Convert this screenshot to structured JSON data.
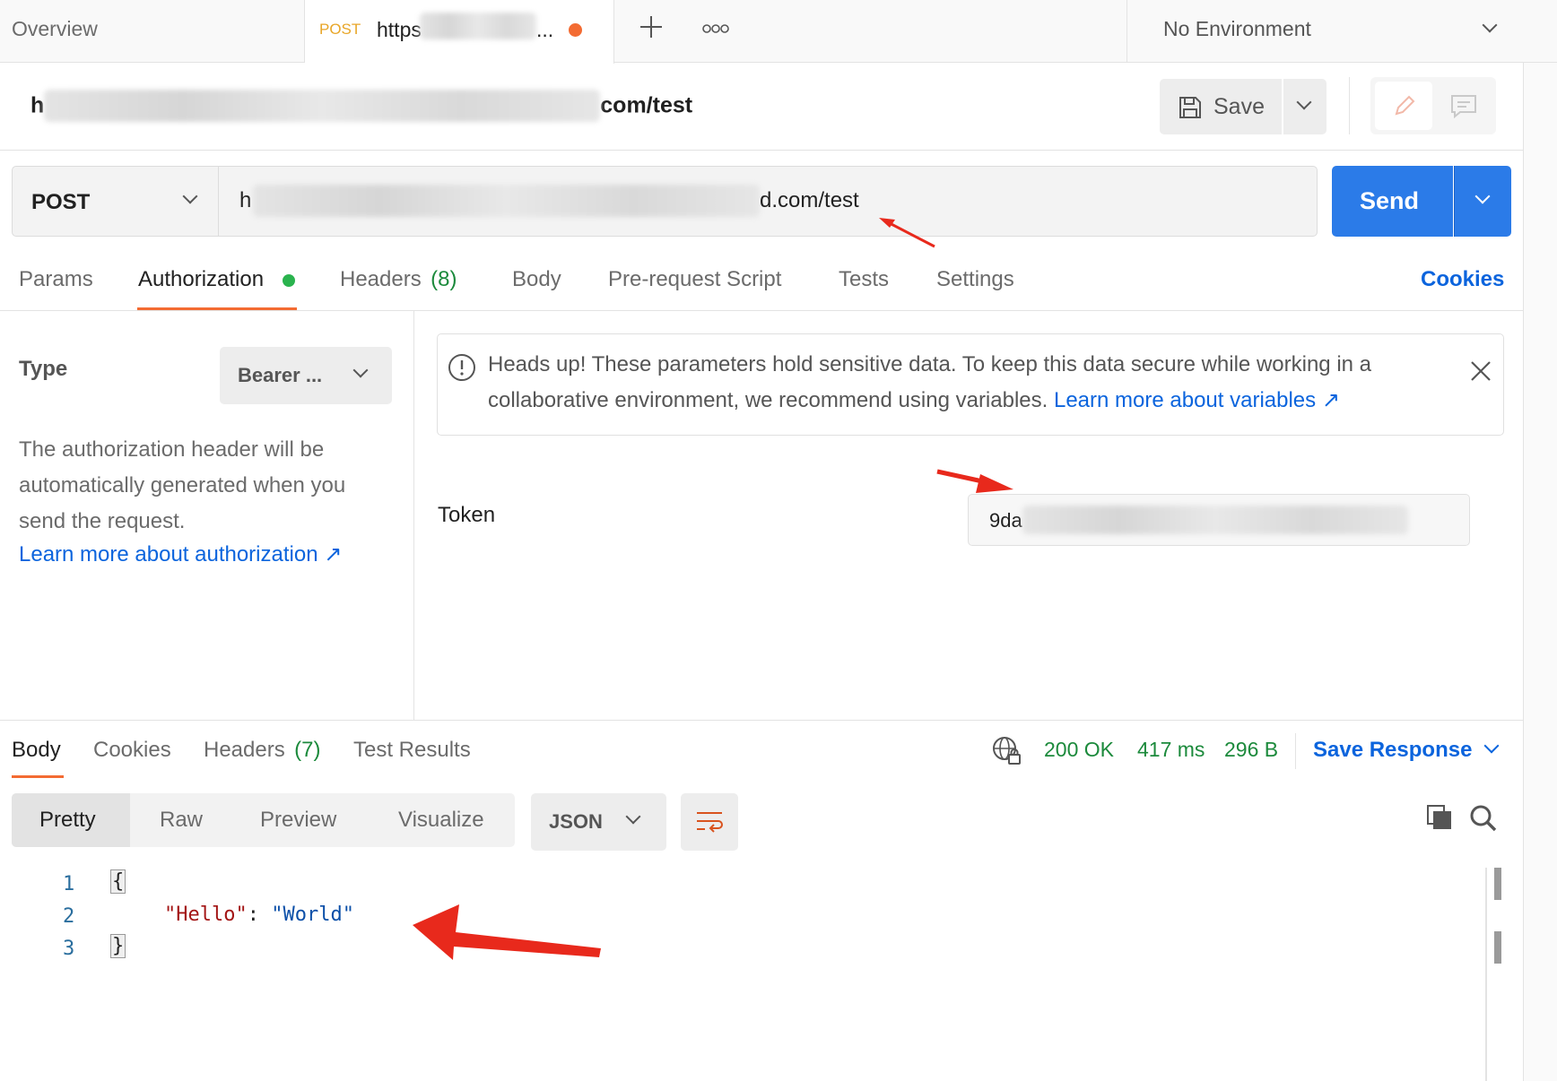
{
  "tabs": {
    "overview": "Overview",
    "active_method": "POST",
    "active_url_prefix": "https",
    "active_url_suffix": "...",
    "env": "No Environment"
  },
  "request": {
    "title_prefix": "h",
    "title_suffix": "com/test",
    "save_label": "Save",
    "method": "POST",
    "url_prefix": "h",
    "url_suffix": "d.com/test",
    "send_label": "Send"
  },
  "req_tabs": {
    "params": "Params",
    "authorization": "Authorization",
    "headers": "Headers",
    "headers_count": "(8)",
    "body": "Body",
    "prerequest": "Pre-request Script",
    "tests": "Tests",
    "settings": "Settings",
    "cookies": "Cookies"
  },
  "auth": {
    "type_label": "Type",
    "type_value": "Bearer ...",
    "description": "The authorization header will be automatically generated when you send the request.",
    "learn_more": "Learn more about authorization ↗",
    "notice_text": "Heads up! These parameters hold sensitive data. To keep this data secure while working in a collaborative environment, we recommend using variables.",
    "notice_link": "Learn more about variables ↗",
    "token_label": "Token",
    "token_prefix": "9da"
  },
  "response": {
    "tabs": {
      "body": "Body",
      "cookies": "Cookies",
      "headers": "Headers",
      "headers_count": "(7)",
      "test_results": "Test Results"
    },
    "status": "200 OK",
    "time": "417 ms",
    "size": "296 B",
    "save_response": "Save Response",
    "views": {
      "pretty": "Pretty",
      "raw": "Raw",
      "preview": "Preview",
      "visualize": "Visualize"
    },
    "format": "JSON",
    "code": {
      "line1_num": "1",
      "line2_num": "2",
      "line3_num": "3",
      "open_brace": "{",
      "key": "\"Hello\"",
      "colon": ": ",
      "value": "\"World\"",
      "close_brace": "}"
    }
  },
  "colors": {
    "accent_blue": "#0b64dd",
    "send_blue": "#2b7be8",
    "orange": "#f36b32",
    "green": "#1c8a3c",
    "annotation_red": "#e8291c"
  }
}
